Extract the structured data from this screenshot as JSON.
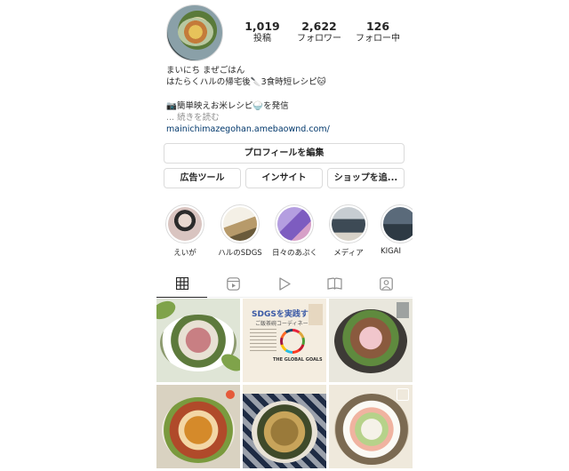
{
  "profile": {
    "stats": [
      {
        "value": "1,019",
        "label": "投稿"
      },
      {
        "value": "2,622",
        "label": "フォロワー"
      },
      {
        "value": "126",
        "label": "フォロー中"
      }
    ],
    "bio": {
      "name": "まいにち まぜごはん",
      "line2": "はたらくハルの帰宅後🔪3食時短レシピ🐱",
      "line3": "📷簡単映えお米レシピ🍚を発信",
      "more": "... 続きを読む",
      "link": "mainichimazegohan.amebaownd.com/"
    }
  },
  "buttons": {
    "edit_profile": "プロフィールを編集",
    "ad_tools": "広告ツール",
    "insights": "インサイト",
    "shop": "ショップを追..."
  },
  "highlights": [
    {
      "label": "えいが",
      "color": "#c9b9b5"
    },
    {
      "label": "ハルのSDGS",
      "color": "#8a7a5a"
    },
    {
      "label": "日々のあぷく",
      "color": "#9a7fc9"
    },
    {
      "label": "メディア",
      "color": "#6a7a8a"
    },
    {
      "label": "KIGAI",
      "color": "#4a5a6a"
    }
  ],
  "tabs": [
    {
      "icon": "grid-icon"
    },
    {
      "icon": "reels-icon"
    },
    {
      "icon": "play-icon"
    },
    {
      "icon": "guide-icon"
    },
    {
      "icon": "tagged-icon"
    }
  ],
  "sdgs_post": {
    "title": "SDGSを実践する",
    "subtitle": "ご飯茶碗コーディネート",
    "footer": "THE GLOBAL GOALS"
  }
}
